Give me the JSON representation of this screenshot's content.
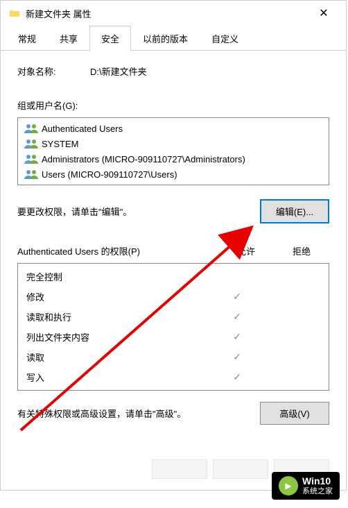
{
  "titlebar": {
    "title": "新建文件夹 属性"
  },
  "tabs": {
    "items": [
      "常规",
      "共享",
      "安全",
      "以前的版本",
      "自定义"
    ],
    "active_index": 2
  },
  "object": {
    "label": "对象名称:",
    "value": "D:\\新建文件夹"
  },
  "groups": {
    "label": "组或用户名(G):",
    "items": [
      "Authenticated Users",
      "SYSTEM",
      "Administrators (MICRO-909110727\\Administrators)",
      "Users (MICRO-909110727\\Users)"
    ]
  },
  "edit": {
    "label": "要更改权限，请单击\"编辑\"。",
    "button": "编辑(E)..."
  },
  "permissions": {
    "header": "Authenticated Users 的权限(P)",
    "allow_col": "允许",
    "deny_col": "拒绝",
    "rows": [
      {
        "name": "完全控制",
        "allow": false,
        "deny": false
      },
      {
        "name": "修改",
        "allow": true,
        "deny": false
      },
      {
        "name": "读取和执行",
        "allow": true,
        "deny": false
      },
      {
        "name": "列出文件夹内容",
        "allow": true,
        "deny": false
      },
      {
        "name": "读取",
        "allow": true,
        "deny": false
      },
      {
        "name": "写入",
        "allow": true,
        "deny": false
      }
    ]
  },
  "advanced": {
    "label": "有关特殊权限或高级设置，请单击\"高级\"。",
    "button": "高级(V)"
  },
  "watermark": {
    "line1": "Win10",
    "line2": "系统之家"
  }
}
